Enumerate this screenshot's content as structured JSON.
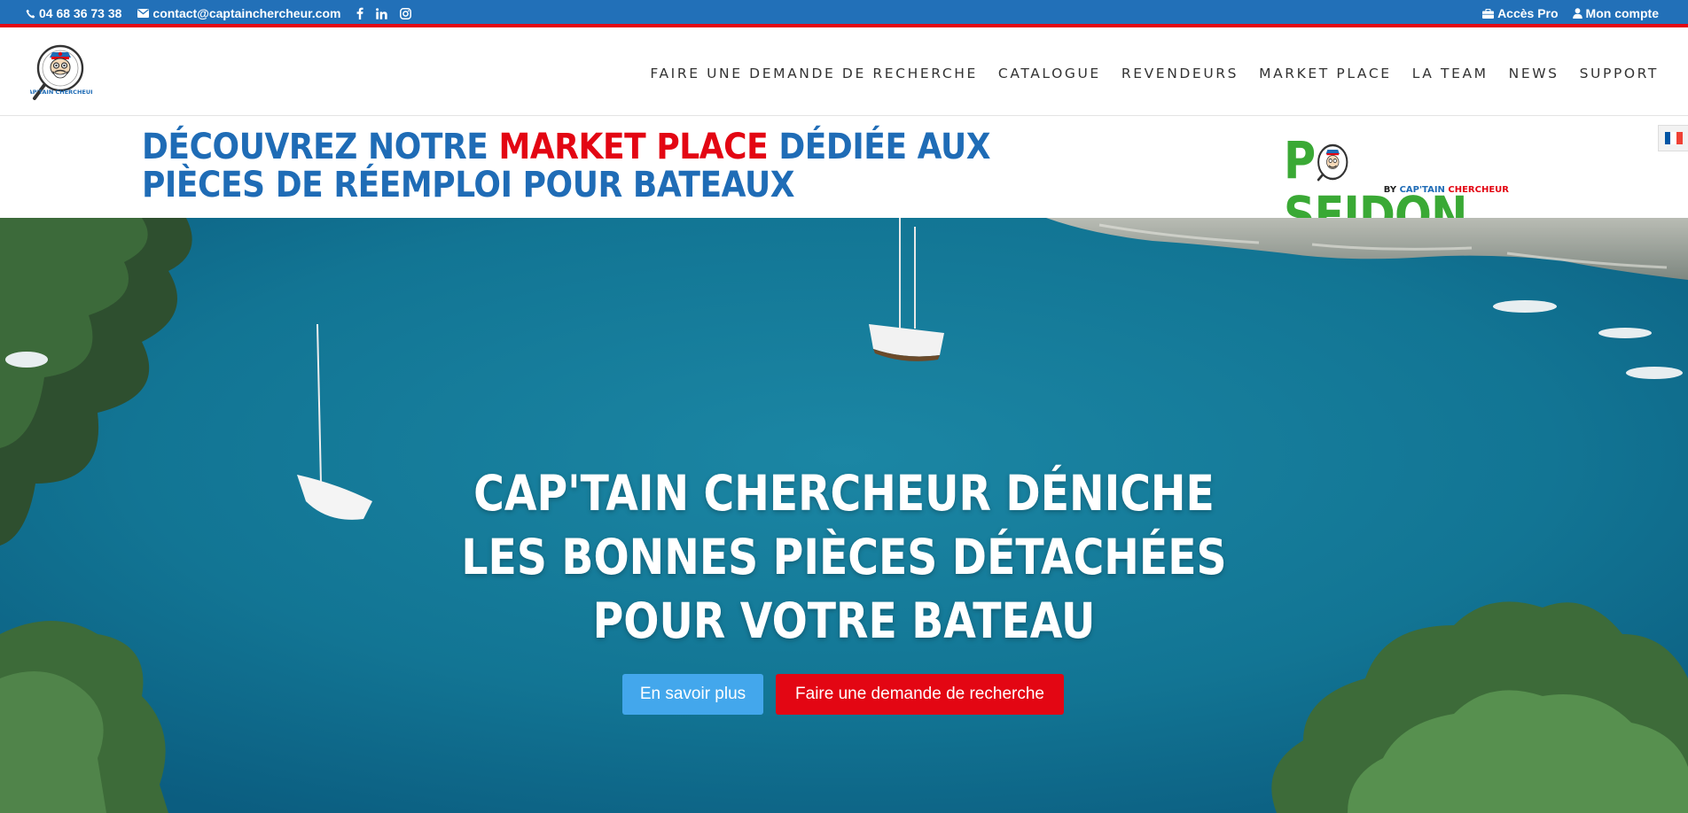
{
  "topbar": {
    "phone": "04 68 36 73 38",
    "email": "contact@captainchercheur.com",
    "social_icons": [
      "facebook-icon",
      "linkedin-icon",
      "instagram-icon"
    ],
    "pro_access": "Accès Pro",
    "account": "Mon compte"
  },
  "header": {
    "logo_alt": "Cap'tain Chercheur",
    "logo_text": "CAP'TAIN CHERCHEUR",
    "nav": [
      "FAIRE UNE DEMANDE DE RECHERCHE",
      "CATALOGUE",
      "REVENDEURS",
      "MARKET PLACE",
      "LA TEAM",
      "NEWS",
      "SUPPORT"
    ]
  },
  "banner": {
    "title_part1": "DÉCOUVREZ NOTRE ",
    "title_highlight": "MARKET PLACE",
    "title_part2": " DÉDIÉE AUX PIÈCES DE RÉEMPLOI POUR BATEAUX",
    "poseidon": {
      "word_before": "P",
      "word_after": "SEIDON",
      "by": "BY ",
      "by_blue": "CAP'TAIN ",
      "by_red": "CHERCHEUR"
    }
  },
  "language": {
    "current": "fr",
    "icon": "france-flag-icon"
  },
  "hero": {
    "title_lines": [
      "CAP'TAIN CHERCHEUR DÉNICHE",
      "LES BONNES PIÈCES DÉTACHÉES",
      "POUR VOTRE BATEAU"
    ],
    "button_primary": "En savoir plus",
    "button_secondary": "Faire une demande de recherche"
  },
  "colors": {
    "brand_blue": "#2270b8",
    "brand_red": "#e30613",
    "poseidon_green": "#3aa935",
    "button_blue": "#43a7ec"
  }
}
